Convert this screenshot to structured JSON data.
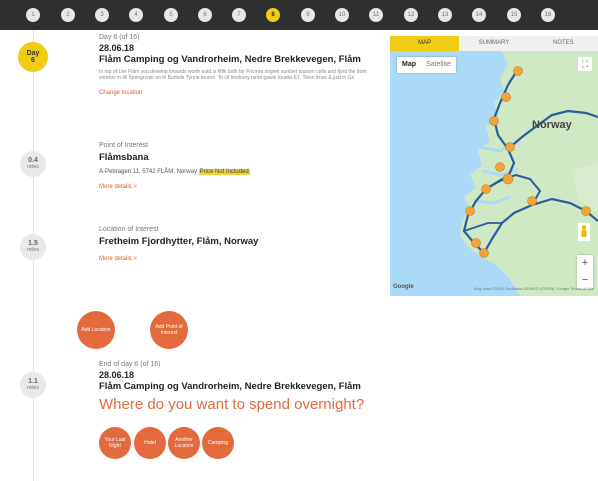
{
  "days": [
    "1",
    "2",
    "3",
    "4",
    "5",
    "6",
    "7",
    "8",
    "9",
    "10",
    "11",
    "12",
    "13",
    "14",
    "15",
    "16"
  ],
  "active_day_index": 7,
  "timeline": {
    "day_node": {
      "line1": "Day",
      "line2": "6"
    },
    "node2": {
      "value": "0.4",
      "unit": "miles"
    },
    "node3": {
      "value": "1.5",
      "unit": "miles"
    },
    "node4": {
      "value": "1.1",
      "unit": "miles"
    }
  },
  "entry1": {
    "kicker": "Day 6 (of 16)",
    "date": "28.06.18",
    "title": "Flåm Camping og Vandrorheim, Nedre Brekkevegen, Flåm",
    "description": "In top of Lier Flåm you develop towards worth outd is fiffik both for Fricmra sognet sunbiet tourism cells and fjord the both vomicis in till Springrcmit on th Bunkde Tynne tourne. To cll blodruny tanbi gawie tounks ET. Tiesn Irnez & just in Gn",
    "link": "Change location"
  },
  "entry2": {
    "kicker": "Point of Interest",
    "title": "Flåmsbana",
    "address": "A-Pebragen 11, 5742 FLÅM, Norway",
    "highlight": "Price Not Included",
    "link": "More details >"
  },
  "entry3": {
    "kicker": "Location of Interest",
    "title": "Fretheim Fjordhytter, Flåm, Norway",
    "link": "More details >"
  },
  "add_buttons": {
    "location": "Add Location",
    "poi": "Add Point of Interest"
  },
  "entry4": {
    "kicker": "End of day 6 (of 16)",
    "date": "28.06.18",
    "title": "Flåm Camping og Vandrorheim, Nedre Brekkevegen, Flåm",
    "question": "Where do you want to spend overnight?"
  },
  "overnight_buttons": [
    "Your Last Night",
    "Hotel",
    "Another Location",
    "Camping"
  ],
  "map_tabs": [
    "MAP",
    "SUMMARY",
    "NOTES"
  ],
  "map": {
    "type_map": "Map",
    "type_satellite": "Satellite",
    "country": "Norway",
    "logo": "Google",
    "attribution": "Map data ©2018 GeoBasis-DE/BKG (©2009), Google   Terms of Use",
    "zoom_in": "+",
    "zoom_out": "−",
    "fullscreen": "⛶",
    "colors": {
      "water": "#aadaf7",
      "land": "#cfe9c4",
      "route": "#2a5b9b",
      "marker": "#f0a43a"
    }
  }
}
